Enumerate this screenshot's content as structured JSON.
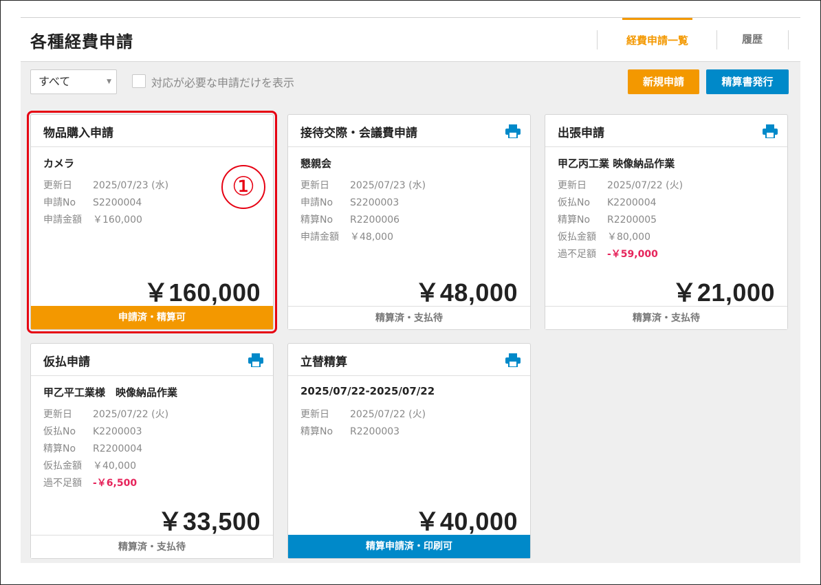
{
  "page": {
    "title": "各種経費申請"
  },
  "nav": {
    "tabs": [
      {
        "label": "経費申請一覧",
        "active": true
      },
      {
        "label": "履歴",
        "active": false
      }
    ]
  },
  "filter": {
    "select_value": "すべて",
    "checkbox_label": "対応が必要な申請だけを表示"
  },
  "buttons": {
    "new_label": "新規申請",
    "issue_label": "精算書発行"
  },
  "colors": {
    "accent_orange": "#f39800",
    "accent_blue": "#0089c9",
    "negative": "#e6245b",
    "highlight": "#e60012"
  },
  "annotation": {
    "label": "①"
  },
  "cards": [
    {
      "title": "物品購入申請",
      "subtitle": "カメラ",
      "rows": [
        {
          "k": "更新日",
          "v": "2025/07/23 (水)"
        },
        {
          "k": "申請No",
          "v": "S2200004"
        },
        {
          "k": "申請金額",
          "v": "￥160,000"
        }
      ],
      "amount": "￥160,000",
      "status": "申請済・精算可",
      "status_style": "orange",
      "printable": false,
      "selected": true
    },
    {
      "title": "接待交際・会議費申請",
      "subtitle": "懇親会",
      "rows": [
        {
          "k": "更新日",
          "v": "2025/07/23 (水)"
        },
        {
          "k": "申請No",
          "v": "S2200003"
        },
        {
          "k": "精算No",
          "v": "R2200006"
        },
        {
          "k": "申請金額",
          "v": "￥48,000"
        }
      ],
      "amount": "￥48,000",
      "status": "精算済・支払待",
      "status_style": "gray",
      "printable": true,
      "selected": false
    },
    {
      "title": "出張申請",
      "subtitle": "甲乙丙工業 映像納品作業",
      "rows": [
        {
          "k": "更新日",
          "v": "2025/07/22 (火)"
        },
        {
          "k": "仮払No",
          "v": "K2200004"
        },
        {
          "k": "精算No",
          "v": "R2200005"
        },
        {
          "k": "仮払金額",
          "v": "￥80,000"
        },
        {
          "k": "過不足額",
          "v": "-￥59,000",
          "negative": true
        }
      ],
      "amount": "￥21,000",
      "status": "精算済・支払待",
      "status_style": "gray",
      "printable": true,
      "selected": false
    },
    {
      "title": "仮払申請",
      "subtitle": "甲乙平工業様　映像納品作業",
      "rows": [
        {
          "k": "更新日",
          "v": "2025/07/22 (火)"
        },
        {
          "k": "仮払No",
          "v": "K2200003"
        },
        {
          "k": "精算No",
          "v": "R2200004"
        },
        {
          "k": "仮払金額",
          "v": "￥40,000"
        },
        {
          "k": "過不足額",
          "v": "-￥6,500",
          "negative": true
        }
      ],
      "amount": "￥33,500",
      "status": "精算済・支払待",
      "status_style": "gray",
      "printable": true,
      "selected": false
    },
    {
      "title": "立替精算",
      "subtitle": "2025/07/22-2025/07/22",
      "rows": [
        {
          "k": "更新日",
          "v": "2025/07/22 (火)"
        },
        {
          "k": "精算No",
          "v": "R2200003"
        }
      ],
      "amount": "￥40,000",
      "status": "精算申請済・印刷可",
      "status_style": "blue",
      "printable": true,
      "selected": false
    }
  ]
}
